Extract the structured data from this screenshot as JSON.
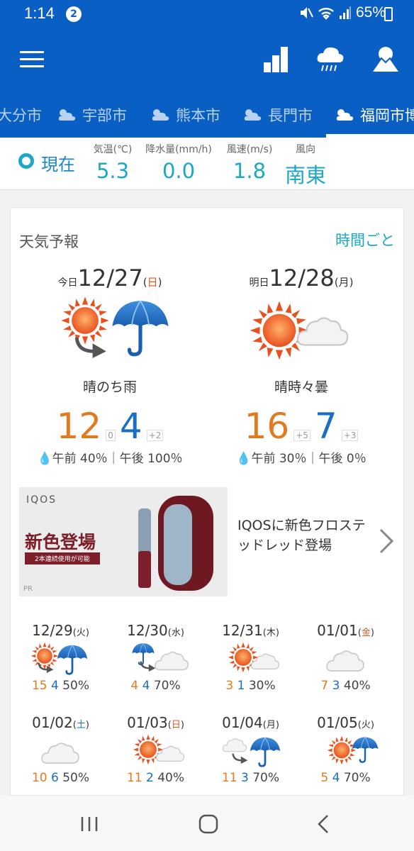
{
  "status": {
    "time": "1:14",
    "notifications": "2",
    "battery": "65%"
  },
  "header": {
    "icons": [
      "menu-icon",
      "ranking-icon",
      "rain-cloud-icon",
      "mountain-sun-icon"
    ]
  },
  "tabs": [
    {
      "label": "大分市",
      "active": false
    },
    {
      "label": "宇部市",
      "active": false
    },
    {
      "label": "熊本市",
      "active": false
    },
    {
      "label": "長門市",
      "active": false
    },
    {
      "label": "福岡市博",
      "active": true
    }
  ],
  "current": {
    "label": "現在",
    "temp_h": "気温(℃)",
    "temp": "5.3",
    "precip_h": "降水量(mm/h)",
    "precip": "0.0",
    "wind_h": "風速(m/s)",
    "wind": "1.8",
    "dir_h": "風向",
    "dir": "南東"
  },
  "forecast": {
    "title": "天気予報",
    "link": "時間ごと",
    "days": [
      {
        "prefix": "今日",
        "date": "12/27",
        "weekday_open": "(",
        "weekday": "日",
        "weekday_close": ")",
        "desc": "晴のち雨",
        "hi": "12",
        "hi_diff": "0",
        "lo": "4",
        "lo_diff": "+2",
        "pop": "午前 40％｜午後 100％"
      },
      {
        "prefix": "明日",
        "date": "12/28",
        "weekday_open": "(",
        "weekday": "月",
        "weekday_close": ")",
        "desc": "晴時々曇",
        "hi": "16",
        "hi_diff": "+5",
        "lo": "7",
        "lo_diff": "+3",
        "pop": "午前 30％｜午後 0％"
      }
    ]
  },
  "ad": {
    "brand": "IQOS",
    "headline": "新色登場",
    "sub": "2本連続使用が可能",
    "pr": "PR",
    "text": "IQOSに新色フロステッドレッド登場"
  },
  "weekly": [
    {
      "date": "12/29",
      "wd": "火",
      "hi": "15",
      "lo": "4",
      "pop": "50%",
      "icon": "sun-rain"
    },
    {
      "date": "12/30",
      "wd": "水",
      "hi": "4",
      "lo": "4",
      "pop": "70%",
      "icon": "rain-cloud"
    },
    {
      "date": "12/31",
      "wd": "木",
      "hi": "3",
      "lo": "1",
      "pop": "30%",
      "icon": "sun-cloud"
    },
    {
      "date": "01/01",
      "wd": "金",
      "hi": "7",
      "lo": "3",
      "pop": "40%",
      "icon": "cloud"
    },
    {
      "date": "01/02",
      "wd": "土",
      "hi": "10",
      "lo": "6",
      "pop": "50%",
      "icon": "cloud"
    },
    {
      "date": "01/03",
      "wd": "日",
      "hi": "11",
      "lo": "2",
      "pop": "40%",
      "icon": "sun-cloud"
    },
    {
      "date": "01/04",
      "wd": "月",
      "hi": "11",
      "lo": "3",
      "pop": "70%",
      "icon": "cloud-rain"
    },
    {
      "date": "01/05",
      "wd": "火",
      "hi": "5",
      "lo": "4",
      "pop": "70%",
      "icon": "sun-rain"
    }
  ],
  "colors": {
    "brand": "#0a5fc4",
    "accent": "#1aa7c8",
    "high": "#e07b20",
    "low": "#1a6fc4"
  }
}
